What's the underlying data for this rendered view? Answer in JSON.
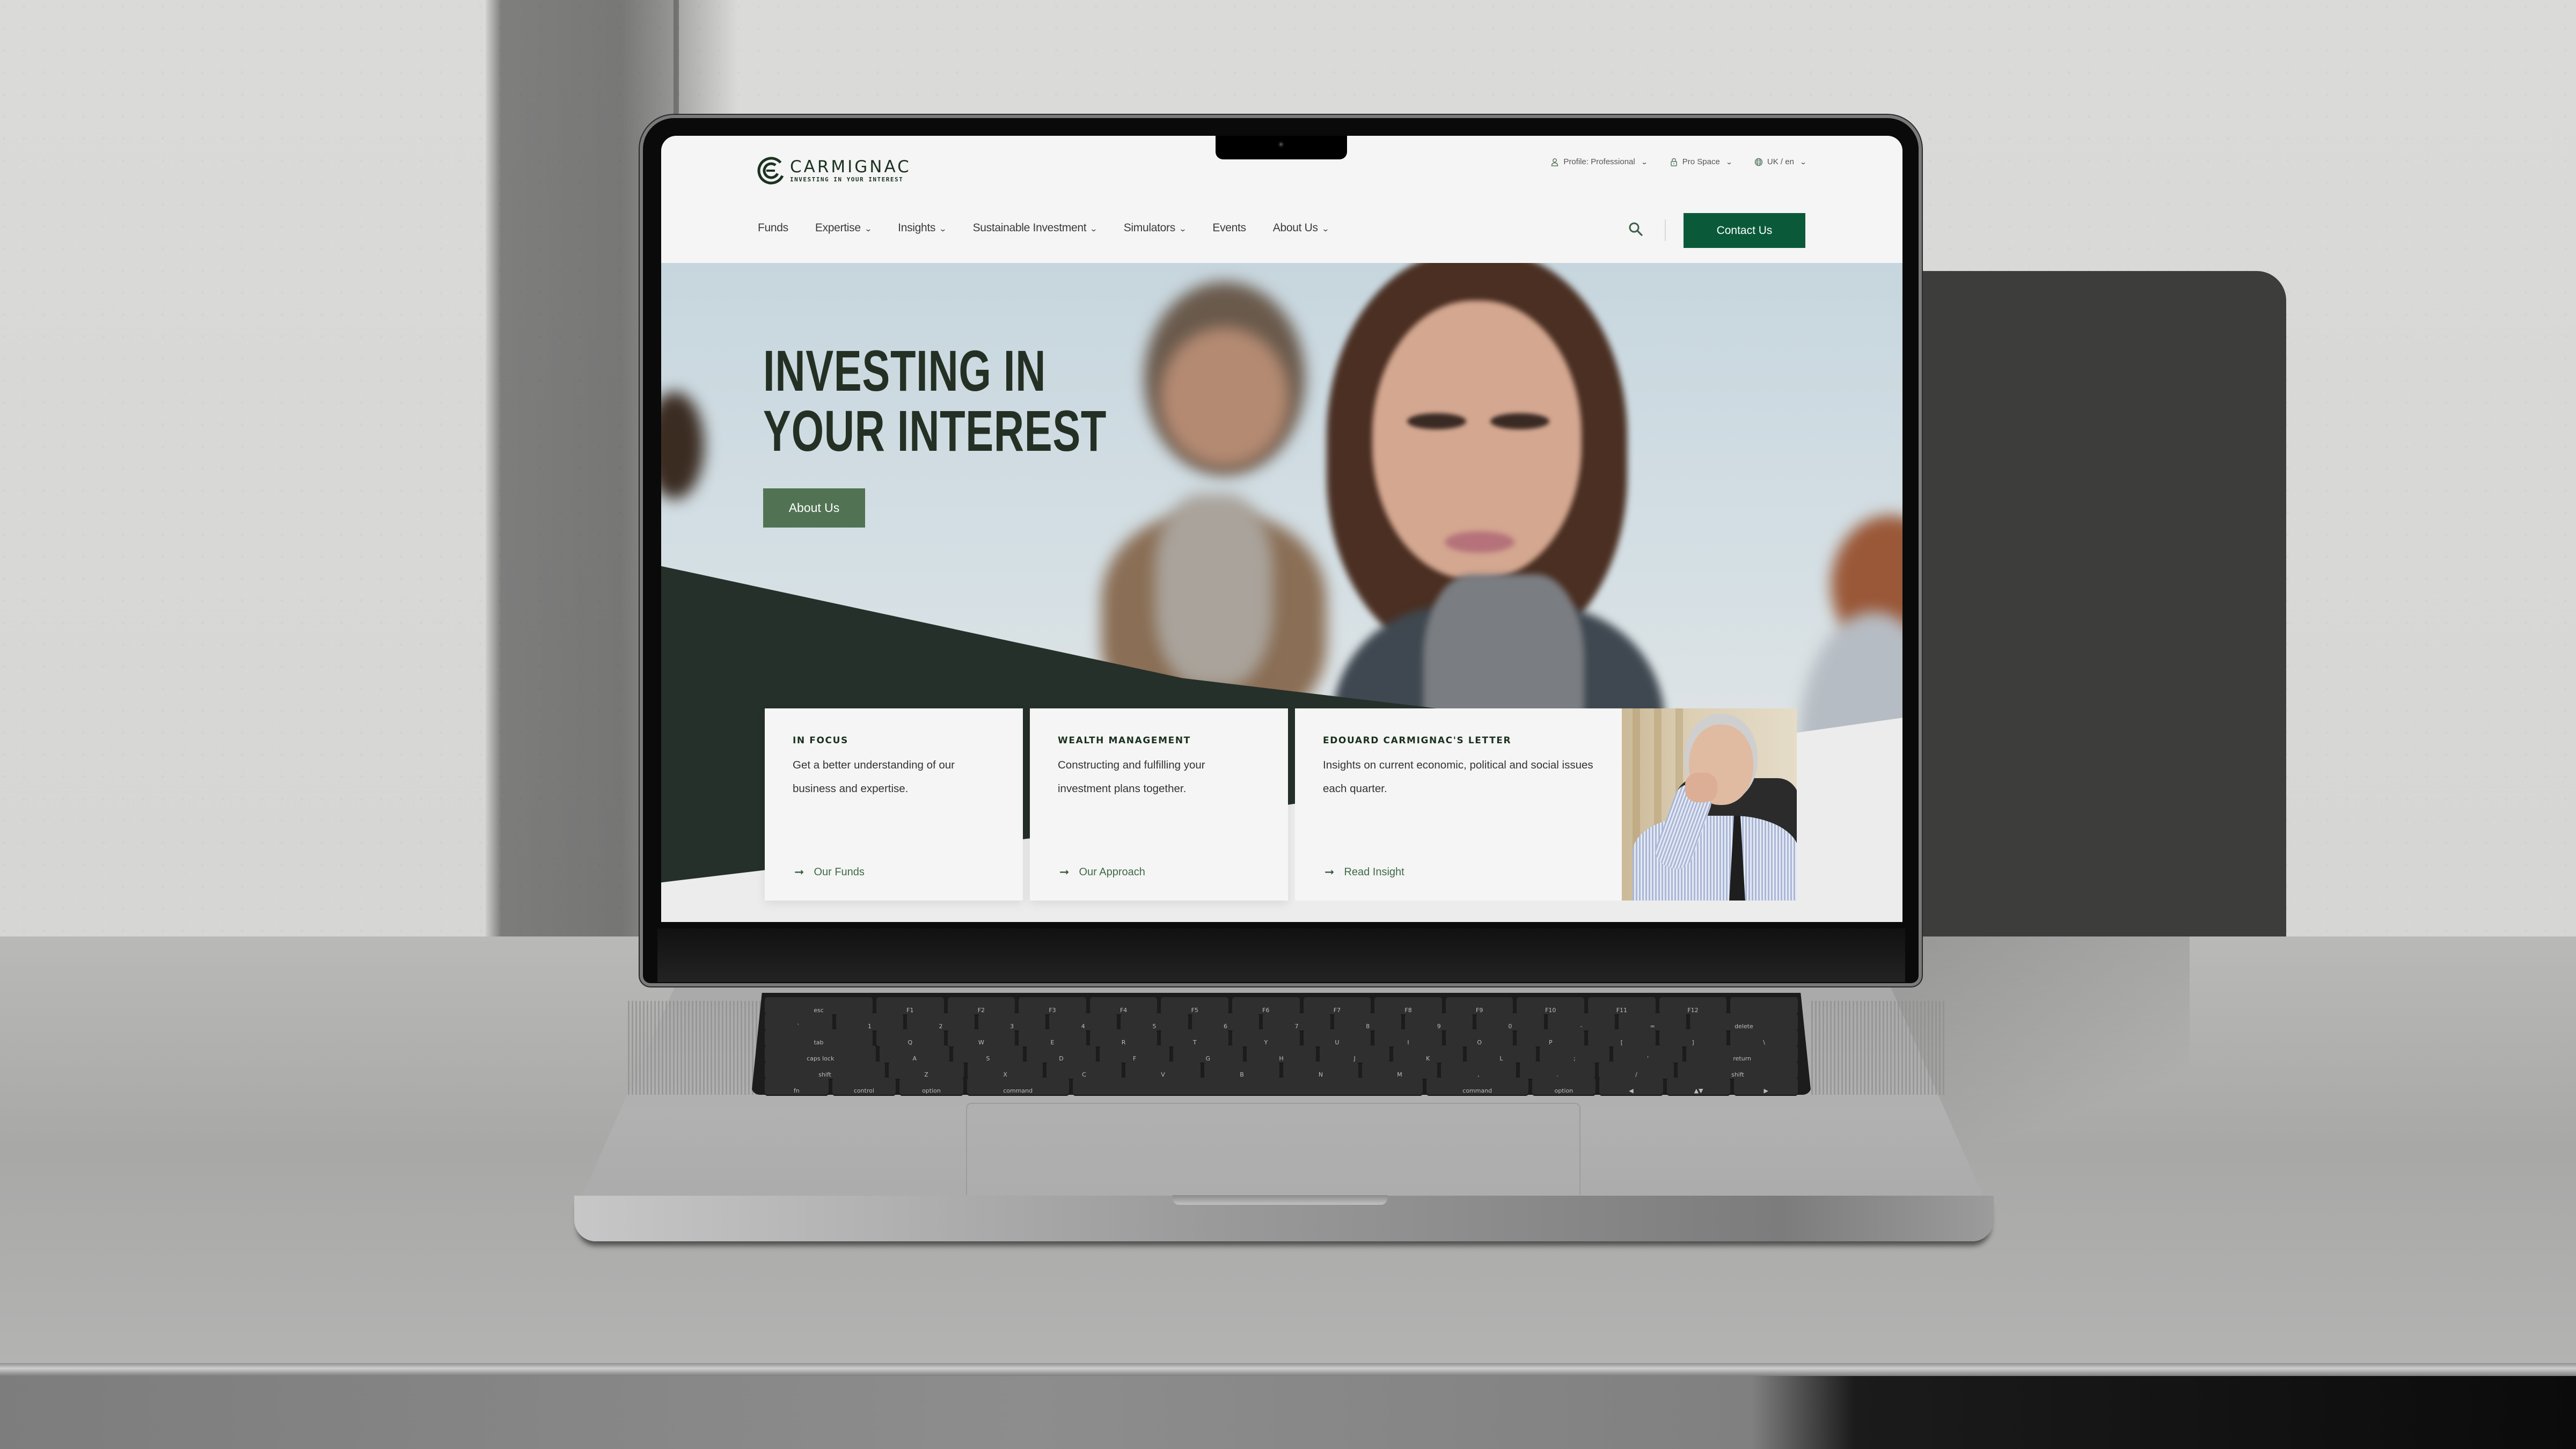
{
  "header": {
    "logo": {
      "name": "CARMIGNAC",
      "tagline": "INVESTING IN YOUR INTEREST"
    },
    "utility": [
      {
        "label": "Profile: Professional",
        "icon": "user-icon",
        "has_dropdown": true
      },
      {
        "label": "Pro Space",
        "icon": "lock-icon",
        "has_dropdown": true
      },
      {
        "label": "UK / en",
        "icon": "globe-icon",
        "has_dropdown": true
      }
    ],
    "nav": [
      {
        "label": "Funds",
        "has_dropdown": false
      },
      {
        "label": "Expertise",
        "has_dropdown": true
      },
      {
        "label": "Insights",
        "has_dropdown": true
      },
      {
        "label": "Sustainable Investment",
        "has_dropdown": true
      },
      {
        "label": "Simulators",
        "has_dropdown": true
      },
      {
        "label": "Events",
        "has_dropdown": false
      },
      {
        "label": "About Us",
        "has_dropdown": true
      }
    ],
    "search_icon": "search-icon",
    "contact_label": "Contact Us"
  },
  "hero": {
    "title_line1": "INVESTING IN",
    "title_line2": "YOUR INTEREST",
    "button_label": "About Us"
  },
  "cards": [
    {
      "title": "IN FOCUS",
      "description": "Get a better understanding of our business and expertise.",
      "link_label": "Our Funds",
      "link_icon": "arrow-right-icon"
    },
    {
      "title": "WEALTH MANAGEMENT",
      "description": "Constructing and fulfilling your investment plans together.",
      "link_label": "Our Approach",
      "link_icon": "arrow-right-icon"
    },
    {
      "title": "EDOUARD CARMIGNAC'S LETTER",
      "description": "Insights on current economic, political and social issues each quarter.",
      "link_label": "Read Insight",
      "link_icon": "arrow-right-icon",
      "image": "portrait-photo"
    }
  ],
  "colors": {
    "brand_dark_green": "#1c3221",
    "contact_button": "#0a5a3a",
    "hero_button": "#517353",
    "hero_band": "#25302a",
    "link_green": "#3e6a47"
  },
  "keyboard": {
    "row_fn": [
      "esc",
      "F1",
      "F2",
      "F3",
      "F4",
      "F5",
      "F6",
      "F7",
      "F8",
      "F9",
      "F10",
      "F11",
      "F12",
      ""
    ],
    "row_num": [
      "`",
      "1",
      "2",
      "3",
      "4",
      "5",
      "6",
      "7",
      "8",
      "9",
      "0",
      "-",
      "=",
      "delete"
    ],
    "row_q": [
      "tab",
      "Q",
      "W",
      "E",
      "R",
      "T",
      "Y",
      "U",
      "I",
      "O",
      "P",
      "[",
      "]",
      "\\"
    ],
    "row_a": [
      "caps lock",
      "A",
      "S",
      "D",
      "F",
      "G",
      "H",
      "J",
      "K",
      "L",
      ";",
      "'",
      "return"
    ],
    "row_z": [
      "shift",
      "Z",
      "X",
      "C",
      "V",
      "B",
      "N",
      "M",
      ",",
      ".",
      "/",
      "shift"
    ],
    "row_mod": [
      "fn",
      "control",
      "option",
      "command",
      "",
      "command",
      "option",
      "◀",
      "▲▼",
      "▶"
    ]
  }
}
